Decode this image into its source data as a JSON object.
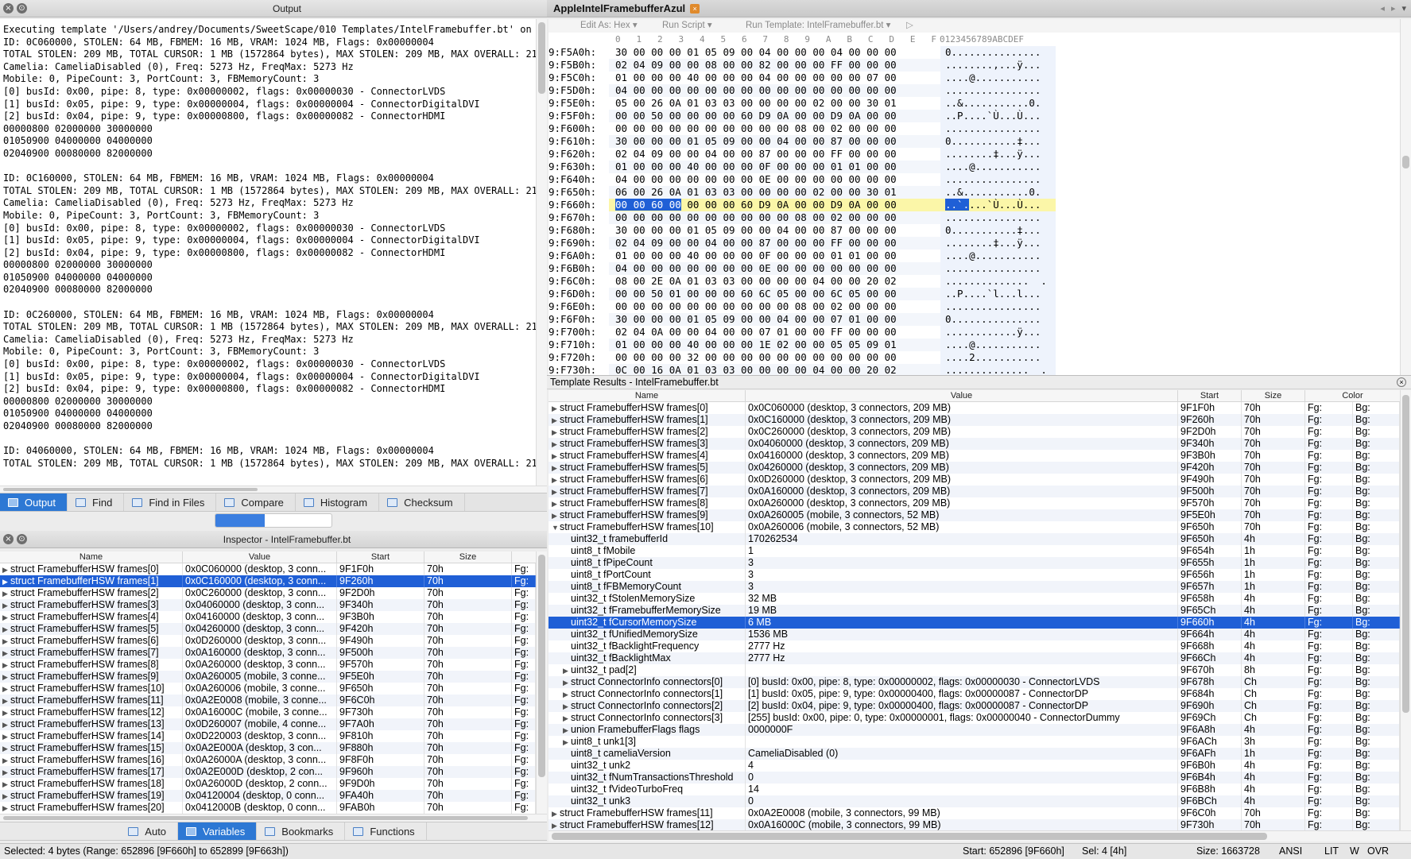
{
  "output": {
    "title": "Output",
    "lines": [
      "Executing template '/Users/andrey/Documents/SweetScape/010 Templates/IntelFramebuffer.bt' on",
      "ID: 0C060000, STOLEN: 64 MB, FBMEM: 16 MB, VRAM: 1024 MB, Flags: 0x00000004",
      "TOTAL STOLEN: 209 MB, TOTAL CURSOR: 1 MB (1572864 bytes), MAX STOLEN: 209 MB, MAX OVERALL: 21",
      "Camelia: CameliaDisabled (0), Freq: 5273 Hz, FreqMax: 5273 Hz",
      "Mobile: 0, PipeCount: 3, PortCount: 3, FBMemoryCount: 3",
      "[0] busId: 0x00, pipe: 8, type: 0x00000002, flags: 0x00000030 - ConnectorLVDS",
      "[1] busId: 0x05, pipe: 9, type: 0x00000004, flags: 0x00000004 - ConnectorDigitalDVI",
      "[2] busId: 0x04, pipe: 9, type: 0x00000800, flags: 0x00000082 - ConnectorHDMI",
      "00000800 02000000 30000000",
      "01050900 04000000 04000000",
      "02040900 00080000 82000000",
      "",
      "ID: 0C160000, STOLEN: 64 MB, FBMEM: 16 MB, VRAM: 1024 MB, Flags: 0x00000004",
      "TOTAL STOLEN: 209 MB, TOTAL CURSOR: 1 MB (1572864 bytes), MAX STOLEN: 209 MB, MAX OVERALL: 21",
      "Camelia: CameliaDisabled (0), Freq: 5273 Hz, FreqMax: 5273 Hz",
      "Mobile: 0, PipeCount: 3, PortCount: 3, FBMemoryCount: 3",
      "[0] busId: 0x00, pipe: 8, type: 0x00000002, flags: 0x00000030 - ConnectorLVDS",
      "[1] busId: 0x05, pipe: 9, type: 0x00000004, flags: 0x00000004 - ConnectorDigitalDVI",
      "[2] busId: 0x04, pipe: 9, type: 0x00000800, flags: 0x00000082 - ConnectorHDMI",
      "00000800 02000000 30000000",
      "01050900 04000000 04000000",
      "02040900 00080000 82000000",
      "",
      "ID: 0C260000, STOLEN: 64 MB, FBMEM: 16 MB, VRAM: 1024 MB, Flags: 0x00000004",
      "TOTAL STOLEN: 209 MB, TOTAL CURSOR: 1 MB (1572864 bytes), MAX STOLEN: 209 MB, MAX OVERALL: 21",
      "Camelia: CameliaDisabled (0), Freq: 5273 Hz, FreqMax: 5273 Hz",
      "Mobile: 0, PipeCount: 3, PortCount: 3, FBMemoryCount: 3",
      "[0] busId: 0x00, pipe: 8, type: 0x00000002, flags: 0x00000030 - ConnectorLVDS",
      "[1] busId: 0x05, pipe: 9, type: 0x00000004, flags: 0x00000004 - ConnectorDigitalDVI",
      "[2] busId: 0x04, pipe: 9, type: 0x00000800, flags: 0x00000082 - ConnectorHDMI",
      "00000800 02000000 30000000",
      "01050900 04000000 04000000",
      "02040900 00080000 82000000",
      "",
      "ID: 04060000, STOLEN: 64 MB, FBMEM: 16 MB, VRAM: 1024 MB, Flags: 0x00000004",
      "TOTAL STOLEN: 209 MB, TOTAL CURSOR: 1 MB (1572864 bytes), MAX STOLEN: 209 MB, MAX OVERALL: 21"
    ]
  },
  "output_tabs": [
    {
      "label": "Output",
      "icon": "output-icon",
      "active": true
    },
    {
      "label": "Find",
      "icon": "find-icon"
    },
    {
      "label": "Find in Files",
      "icon": "find-in-files-icon"
    },
    {
      "label": "Compare",
      "icon": "compare-icon"
    },
    {
      "label": "Histogram",
      "icon": "histogram-icon"
    },
    {
      "label": "Checksum",
      "icon": "checksum-icon"
    }
  ],
  "inspector": {
    "title": "Inspector - IntelFramebuffer.bt",
    "columns": [
      "Name",
      "Value",
      "Start",
      "Size"
    ],
    "rows": [
      {
        "name": "struct FramebufferHSW frames[0]",
        "value": "0x0C060000 (desktop, 3 conn...",
        "start": "9F1F0h",
        "size": "70h",
        "fg": "Fg:"
      },
      {
        "name": "struct FramebufferHSW frames[1]",
        "value": "0x0C160000 (desktop, 3 conn...",
        "start": "9F260h",
        "size": "70h",
        "fg": "Fg:",
        "selected": true
      },
      {
        "name": "struct FramebufferHSW frames[2]",
        "value": "0x0C260000 (desktop, 3 conn...",
        "start": "9F2D0h",
        "size": "70h",
        "fg": "Fg:"
      },
      {
        "name": "struct FramebufferHSW frames[3]",
        "value": "0x04060000 (desktop, 3 conn...",
        "start": "9F340h",
        "size": "70h",
        "fg": "Fg:"
      },
      {
        "name": "struct FramebufferHSW frames[4]",
        "value": "0x04160000 (desktop, 3 conn...",
        "start": "9F3B0h",
        "size": "70h",
        "fg": "Fg:"
      },
      {
        "name": "struct FramebufferHSW frames[5]",
        "value": "0x04260000 (desktop, 3 conn...",
        "start": "9F420h",
        "size": "70h",
        "fg": "Fg:"
      },
      {
        "name": "struct FramebufferHSW frames[6]",
        "value": "0x0D260000 (desktop, 3 conn...",
        "start": "9F490h",
        "size": "70h",
        "fg": "Fg:"
      },
      {
        "name": "struct FramebufferHSW frames[7]",
        "value": "0x0A160000 (desktop, 3 conn...",
        "start": "9F500h",
        "size": "70h",
        "fg": "Fg:"
      },
      {
        "name": "struct FramebufferHSW frames[8]",
        "value": "0x0A260000 (desktop, 3 conn...",
        "start": "9F570h",
        "size": "70h",
        "fg": "Fg:"
      },
      {
        "name": "struct FramebufferHSW frames[9]",
        "value": "0x0A260005 (mobile, 3 conne...",
        "start": "9F5E0h",
        "size": "70h",
        "fg": "Fg:"
      },
      {
        "name": "struct FramebufferHSW frames[10]",
        "value": "0x0A260006 (mobile, 3 conne...",
        "start": "9F650h",
        "size": "70h",
        "fg": "Fg:"
      },
      {
        "name": "struct FramebufferHSW frames[11]",
        "value": "0x0A2E0008 (mobile, 3 conne...",
        "start": "9F6C0h",
        "size": "70h",
        "fg": "Fg:"
      },
      {
        "name": "struct FramebufferHSW frames[12]",
        "value": "0x0A16000C (mobile, 3 conne...",
        "start": "9F730h",
        "size": "70h",
        "fg": "Fg:"
      },
      {
        "name": "struct FramebufferHSW frames[13]",
        "value": "0x0D260007 (mobile, 4 conne...",
        "start": "9F7A0h",
        "size": "70h",
        "fg": "Fg:"
      },
      {
        "name": "struct FramebufferHSW frames[14]",
        "value": "0x0D220003 (desktop, 3 conn...",
        "start": "9F810h",
        "size": "70h",
        "fg": "Fg:"
      },
      {
        "name": "struct FramebufferHSW frames[15]",
        "value": "0x0A2E000A (desktop, 3 con...",
        "start": "9F880h",
        "size": "70h",
        "fg": "Fg:"
      },
      {
        "name": "struct FramebufferHSW frames[16]",
        "value": "0x0A26000A (desktop, 3 conn...",
        "start": "9F8F0h",
        "size": "70h",
        "fg": "Fg:"
      },
      {
        "name": "struct FramebufferHSW frames[17]",
        "value": "0x0A2E000D (desktop, 2 con...",
        "start": "9F960h",
        "size": "70h",
        "fg": "Fg:"
      },
      {
        "name": "struct FramebufferHSW frames[18]",
        "value": "0x0A26000D (desktop, 2 conn...",
        "start": "9F9D0h",
        "size": "70h",
        "fg": "Fg:"
      },
      {
        "name": "struct FramebufferHSW frames[19]",
        "value": "0x04120004 (desktop, 0 conn...",
        "start": "9FA40h",
        "size": "70h",
        "fg": "Fg:"
      },
      {
        "name": "struct FramebufferHSW frames[20]",
        "value": "0x0412000B (desktop, 0 conn...",
        "start": "9FAB0h",
        "size": "70h",
        "fg": "Fg:"
      }
    ]
  },
  "inspector_tabs": [
    {
      "label": "Auto",
      "icon": "auto-icon"
    },
    {
      "label": "Variables",
      "icon": "variables-icon",
      "active": true
    },
    {
      "label": "Bookmarks",
      "icon": "bookmarks-icon"
    },
    {
      "label": "Functions",
      "icon": "functions-icon"
    }
  ],
  "editor": {
    "file_tab": "AppleIntelFramebufferAzul",
    "toolbar": {
      "edit_as": "Edit As: Hex",
      "run_script": "Run Script",
      "run_template": "Run Template: IntelFramebuffer.bt"
    },
    "col_header": "0   1   2   3   4   5   6   7   8   9   A   B   C   D   E   F",
    "ascii_header": "0123456789ABCDEF",
    "rows": [
      {
        "addr": "9:F5A0h:",
        "bytes": "30 00 00 00 01 05 09 00 04 00 00 00 04 00 00 00",
        "ascii": "0..............."
      },
      {
        "addr": "9:F5B0h:",
        "bytes": "02 04 09 00 00 08 00 00 82 00 00 00 FF 00 00 00",
        "ascii": "........‚...ÿ..."
      },
      {
        "addr": "9:F5C0h:",
        "bytes": "01 00 00 00 40 00 00 00 04 00 00 00 00 00 07 00",
        "ascii": "....@..........."
      },
      {
        "addr": "9:F5D0h:",
        "bytes": "04 00 00 00 00 00 00 00 00 00 00 00 00 00 00 00",
        "ascii": "................"
      },
      {
        "addr": "9:F5E0h:",
        "bytes": "05 00 26 0A 01 03 03 00 00 00 00 02 00 00 30 01",
        "ascii": "..&...........0."
      },
      {
        "addr": "9:F5F0h:",
        "bytes": "00 00 50 00 00 00 00 60 D9 0A 00 00 D9 0A 00 00",
        "ascii": "..P....`Ù...Ù..."
      },
      {
        "addr": "9:F600h:",
        "bytes": "00 00 00 00 00 00 00 00 00 00 08 00 02 00 00 00",
        "ascii": "................"
      },
      {
        "addr": "9:F610h:",
        "bytes": "30 00 00 00 01 05 09 00 00 04 00 00 87 00 00 00",
        "ascii": "0...........‡..."
      },
      {
        "addr": "9:F620h:",
        "bytes": "02 04 09 00 00 04 00 00 87 00 00 00 FF 00 00 00",
        "ascii": "........‡...ÿ..."
      },
      {
        "addr": "9:F630h:",
        "bytes": "01 00 00 00 40 00 00 00 0F 00 00 00 01 01 00 00",
        "ascii": "....@..........."
      },
      {
        "addr": "9:F640h:",
        "bytes": "04 00 00 00 00 00 00 00 0E 00 00 00 00 00 00 00",
        "ascii": "................"
      },
      {
        "addr": "9:F650h:",
        "bytes": "06 00 26 0A 01 03 03 00 00 00 00 02 00 00 30 01",
        "ascii": "..&...........0."
      },
      {
        "addr": "9:F660h:",
        "bytes_sel": "00 00 60 00",
        "bytes": " 00 00 00 60 D9 0A 00 00 D9 0A 00 00",
        "ascii_sel": "..`.",
        "ascii": "...`Ù...Ù...",
        "highlight": true
      },
      {
        "addr": "9:F670h:",
        "bytes": "00 00 00 00 00 00 00 00 00 00 08 00 02 00 00 00",
        "ascii": "................"
      },
      {
        "addr": "9:F680h:",
        "bytes": "30 00 00 00 01 05 09 00 00 04 00 00 87 00 00 00",
        "ascii": "0...........‡..."
      },
      {
        "addr": "9:F690h:",
        "bytes": "02 04 09 00 00 04 00 00 87 00 00 00 FF 00 00 00",
        "ascii": "........‡...ÿ..."
      },
      {
        "addr": "9:F6A0h:",
        "bytes": "01 00 00 00 40 00 00 00 0F 00 00 00 01 01 00 00",
        "ascii": "....@..........."
      },
      {
        "addr": "9:F6B0h:",
        "bytes": "04 00 00 00 00 00 00 00 0E 00 00 00 00 00 00 00",
        "ascii": "................"
      },
      {
        "addr": "9:F6C0h:",
        "bytes": "08 00 2E 0A 01 03 03 00 00 00 00 04 00 00 20 02",
        "ascii": "..............  ."
      },
      {
        "addr": "9:F6D0h:",
        "bytes": "00 00 50 01 00 00 00 60 6C 05 00 00 6C 05 00 00",
        "ascii": "..P....`l...l..."
      },
      {
        "addr": "9:F6E0h:",
        "bytes": "00 00 00 00 00 00 00 00 00 00 08 00 02 00 00 00",
        "ascii": "................"
      },
      {
        "addr": "9:F6F0h:",
        "bytes": "30 00 00 00 01 05 09 00 00 04 00 00 07 01 00 00",
        "ascii": "0..............."
      },
      {
        "addr": "9:F700h:",
        "bytes": "02 04 0A 00 00 04 00 00 07 01 00 00 FF 00 00 00",
        "ascii": "............ÿ..."
      },
      {
        "addr": "9:F710h:",
        "bytes": "01 00 00 00 40 00 00 00 1E 02 00 00 05 05 09 01",
        "ascii": "....@..........."
      },
      {
        "addr": "9:F720h:",
        "bytes": "00 00 00 00 32 00 00 00 00 00 00 00 00 00 00 00",
        "ascii": "....2..........."
      },
      {
        "addr": "9:F730h:",
        "bytes": "0C 00 16 0A 01 03 03 00 00 00 00 04 00 00 20 02",
        "ascii": "..............  ."
      }
    ]
  },
  "template_results": {
    "title": "Template Results - IntelFramebuffer.bt",
    "columns": [
      "Name",
      "Value",
      "Start",
      "Size",
      "Color"
    ],
    "rows": [
      {
        "indent": 0,
        "expand": "▶",
        "name": "struct FramebufferHSW frames[0]",
        "value": "0x0C060000 (desktop, 3 connectors, 209 MB)",
        "start": "9F1F0h",
        "size": "70h"
      },
      {
        "indent": 0,
        "expand": "▶",
        "name": "struct FramebufferHSW frames[1]",
        "value": "0x0C160000 (desktop, 3 connectors, 209 MB)",
        "start": "9F260h",
        "size": "70h"
      },
      {
        "indent": 0,
        "expand": "▶",
        "name": "struct FramebufferHSW frames[2]",
        "value": "0x0C260000 (desktop, 3 connectors, 209 MB)",
        "start": "9F2D0h",
        "size": "70h"
      },
      {
        "indent": 0,
        "expand": "▶",
        "name": "struct FramebufferHSW frames[3]",
        "value": "0x04060000 (desktop, 3 connectors, 209 MB)",
        "start": "9F340h",
        "size": "70h"
      },
      {
        "indent": 0,
        "expand": "▶",
        "name": "struct FramebufferHSW frames[4]",
        "value": "0x04160000 (desktop, 3 connectors, 209 MB)",
        "start": "9F3B0h",
        "size": "70h"
      },
      {
        "indent": 0,
        "expand": "▶",
        "name": "struct FramebufferHSW frames[5]",
        "value": "0x04260000 (desktop, 3 connectors, 209 MB)",
        "start": "9F420h",
        "size": "70h"
      },
      {
        "indent": 0,
        "expand": "▶",
        "name": "struct FramebufferHSW frames[6]",
        "value": "0x0D260000 (desktop, 3 connectors, 209 MB)",
        "start": "9F490h",
        "size": "70h"
      },
      {
        "indent": 0,
        "expand": "▶",
        "name": "struct FramebufferHSW frames[7]",
        "value": "0x0A160000 (desktop, 3 connectors, 209 MB)",
        "start": "9F500h",
        "size": "70h"
      },
      {
        "indent": 0,
        "expand": "▶",
        "name": "struct FramebufferHSW frames[8]",
        "value": "0x0A260000 (desktop, 3 connectors, 209 MB)",
        "start": "9F570h",
        "size": "70h"
      },
      {
        "indent": 0,
        "expand": "▶",
        "name": "struct FramebufferHSW frames[9]",
        "value": "0x0A260005 (mobile, 3 connectors, 52 MB)",
        "start": "9F5E0h",
        "size": "70h"
      },
      {
        "indent": 0,
        "expand": "▼",
        "name": "struct FramebufferHSW frames[10]",
        "value": "0x0A260006 (mobile, 3 connectors, 52 MB)",
        "start": "9F650h",
        "size": "70h"
      },
      {
        "indent": 1,
        "expand": "",
        "name": "uint32_t framebufferId",
        "value": "170262534",
        "start": "9F650h",
        "size": "4h"
      },
      {
        "indent": 1,
        "expand": "",
        "name": "uint8_t fMobile",
        "value": "1",
        "start": "9F654h",
        "size": "1h"
      },
      {
        "indent": 1,
        "expand": "",
        "name": "uint8_t fPipeCount",
        "value": "3",
        "start": "9F655h",
        "size": "1h"
      },
      {
        "indent": 1,
        "expand": "",
        "name": "uint8_t fPortCount",
        "value": "3",
        "start": "9F656h",
        "size": "1h"
      },
      {
        "indent": 1,
        "expand": "",
        "name": "uint8_t fFBMemoryCount",
        "value": "3",
        "start": "9F657h",
        "size": "1h"
      },
      {
        "indent": 1,
        "expand": "",
        "name": "uint32_t fStolenMemorySize",
        "value": "32 MB",
        "start": "9F658h",
        "size": "4h"
      },
      {
        "indent": 1,
        "expand": "",
        "name": "uint32_t fFramebufferMemorySize",
        "value": "19 MB",
        "start": "9F65Ch",
        "size": "4h"
      },
      {
        "indent": 1,
        "expand": "",
        "name": "uint32_t fCursorMemorySize",
        "value": "6 MB",
        "start": "9F660h",
        "size": "4h",
        "selected": true
      },
      {
        "indent": 1,
        "expand": "",
        "name": "uint32_t fUnifiedMemorySize",
        "value": "1536 MB",
        "start": "9F664h",
        "size": "4h"
      },
      {
        "indent": 1,
        "expand": "",
        "name": "uint32_t fBacklightFrequency",
        "value": "2777 Hz",
        "start": "9F668h",
        "size": "4h"
      },
      {
        "indent": 1,
        "expand": "",
        "name": "uint32_t fBacklightMax",
        "value": "2777 Hz",
        "start": "9F66Ch",
        "size": "4h"
      },
      {
        "indent": 1,
        "expand": "▶",
        "name": "uint32_t pad[2]",
        "value": "",
        "start": "9F670h",
        "size": "8h"
      },
      {
        "indent": 1,
        "expand": "▶",
        "name": "struct ConnectorInfo connectors[0]",
        "value": "[0] busId: 0x00, pipe: 8, type: 0x00000002, flags: 0x00000030 - ConnectorLVDS",
        "start": "9F678h",
        "size": "Ch"
      },
      {
        "indent": 1,
        "expand": "▶",
        "name": "struct ConnectorInfo connectors[1]",
        "value": "[1] busId: 0x05, pipe: 9, type: 0x00000400, flags: 0x00000087 - ConnectorDP",
        "start": "9F684h",
        "size": "Ch"
      },
      {
        "indent": 1,
        "expand": "▶",
        "name": "struct ConnectorInfo connectors[2]",
        "value": "[2] busId: 0x04, pipe: 9, type: 0x00000400, flags: 0x00000087 - ConnectorDP",
        "start": "9F690h",
        "size": "Ch"
      },
      {
        "indent": 1,
        "expand": "▶",
        "name": "struct ConnectorInfo connectors[3]",
        "value": "[255] busId: 0x00, pipe: 0, type: 0x00000001, flags: 0x00000040 - ConnectorDummy",
        "start": "9F69Ch",
        "size": "Ch"
      },
      {
        "indent": 1,
        "expand": "▶",
        "name": "union FramebufferFlags flags",
        "value": "0000000F",
        "start": "9F6A8h",
        "size": "4h"
      },
      {
        "indent": 1,
        "expand": "▶",
        "name": "uint8_t unk1[3]",
        "value": "",
        "start": "9F6ACh",
        "size": "3h"
      },
      {
        "indent": 1,
        "expand": "",
        "name": "uint8_t cameliaVersion",
        "value": "CameliaDisabled (0)",
        "start": "9F6AFh",
        "size": "1h"
      },
      {
        "indent": 1,
        "expand": "",
        "name": "uint32_t unk2",
        "value": "4",
        "start": "9F6B0h",
        "size": "4h"
      },
      {
        "indent": 1,
        "expand": "",
        "name": "uint32_t fNumTransactionsThreshold",
        "value": "0",
        "start": "9F6B4h",
        "size": "4h"
      },
      {
        "indent": 1,
        "expand": "",
        "name": "uint32_t fVideoTurboFreq",
        "value": "14",
        "start": "9F6B8h",
        "size": "4h"
      },
      {
        "indent": 1,
        "expand": "",
        "name": "uint32_t unk3",
        "value": "0",
        "start": "9F6BCh",
        "size": "4h"
      },
      {
        "indent": 0,
        "expand": "▶",
        "name": "struct FramebufferHSW frames[11]",
        "value": "0x0A2E0008 (mobile, 3 connectors, 99 MB)",
        "start": "9F6C0h",
        "size": "70h"
      },
      {
        "indent": 0,
        "expand": "▶",
        "name": "struct FramebufferHSW frames[12]",
        "value": "0x0A16000C (mobile, 3 connectors, 99 MB)",
        "start": "9F730h",
        "size": "70h"
      }
    ],
    "fg": "Fg:",
    "bg": "Bg:"
  },
  "status": {
    "selected": "Selected: 4 bytes (Range: 652896 [9F660h] to 652899 [9F663h])",
    "start": "Start: 652896 [9F660h]",
    "sel": "Sel: 4 [4h]",
    "size": "Size: 1663728",
    "encoding": "ANSI",
    "lit": "LIT",
    "w": "W",
    "ovr": "OVR"
  },
  "colors": {
    "selection": "#1f5fd6",
    "highlight_row": "#fbf6a8",
    "tab_active": "#2d78d4"
  }
}
